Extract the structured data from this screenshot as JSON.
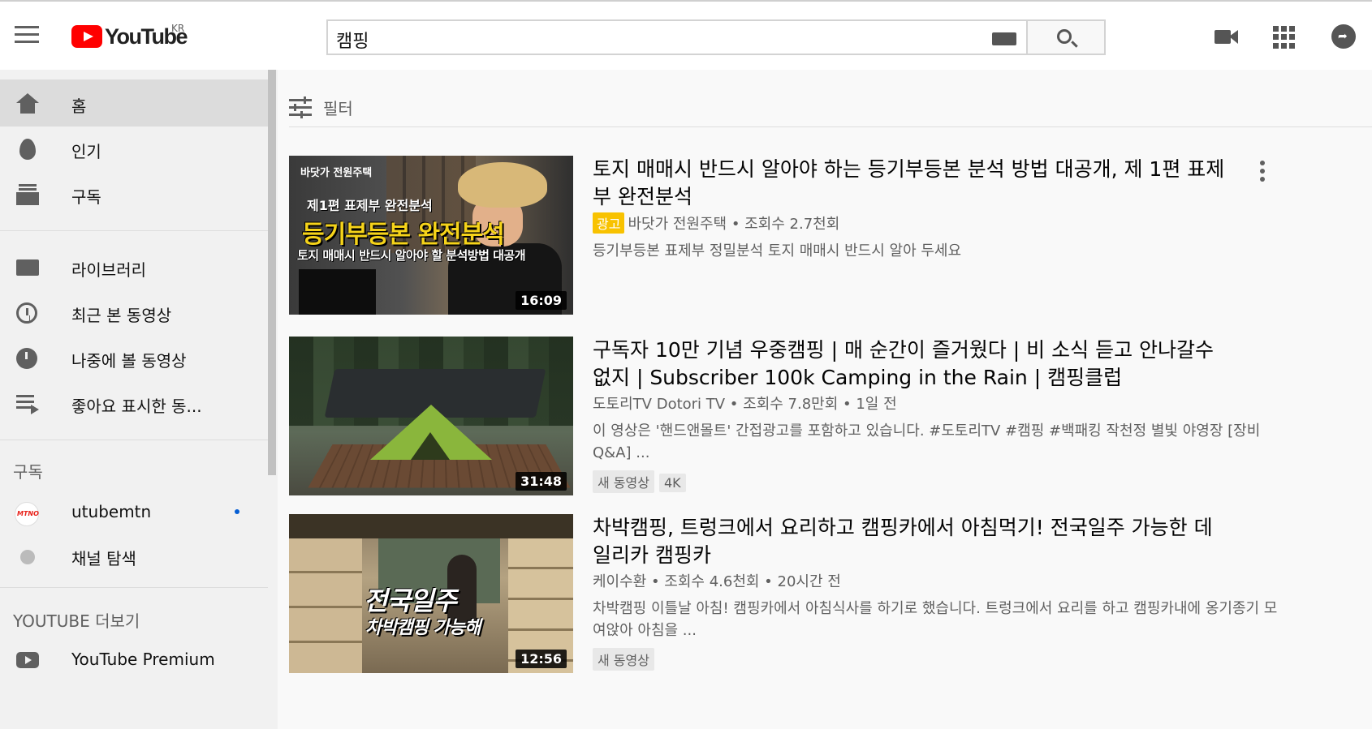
{
  "header": {
    "logo_text": "YouTube",
    "region": "KR",
    "search_query": "캠핑"
  },
  "sidebar": {
    "main_items": [
      {
        "label": "홈",
        "icon": "home-icon",
        "active": true
      },
      {
        "label": "인기",
        "icon": "fire-icon"
      },
      {
        "label": "구독",
        "icon": "subscriptions-icon"
      }
    ],
    "library_items": [
      {
        "label": "라이브러리",
        "icon": "folder-icon"
      },
      {
        "label": "최근 본 동영상",
        "icon": "history-icon"
      },
      {
        "label": "나중에 볼 동영상",
        "icon": "clock-icon"
      },
      {
        "label": "좋아요 표시한 동...",
        "icon": "playlist-icon"
      }
    ],
    "subscriptions_title": "구독",
    "subscriptions": [
      {
        "label": "utubemtn",
        "avatar_text": "MTNO",
        "new_content": true
      },
      {
        "label": "채널 탐색",
        "icon": "add-circle-icon"
      }
    ],
    "more_title": "YOUTUBE 더보기",
    "more_items": [
      {
        "label": "YouTube Premium",
        "icon": "youtube-icon"
      }
    ]
  },
  "filter": {
    "label": "필터"
  },
  "videos": [
    {
      "title": "토지 매매시 반드시 알아야 하는 등기부등본 분석 방법 대공개, 제 1편 표제부 완전분석",
      "ad_label": "광고",
      "channel": "바닷가 전원주택",
      "views": "조회수 2.7천회",
      "meta_line": "바닷가 전원주택 • 조회수 2.7천회",
      "description": "등기부등본 표제부 정밀분석 토지 매매시 반드시 알아 두세요",
      "duration": "16:09",
      "thumb_text": [
        "바닷가 전원주택",
        "제1편 표제부 완전분석",
        "등기부등본 완전분석",
        "토지 매매시 반드시 알아야 할 분석방법 대공개"
      ]
    },
    {
      "title": "구독자 10만 기념 우중캠핑 | 매 순간이 즐거웠다 | 비 소식 듣고 안나갈수 없지 | Subscriber 100k Camping in the Rain | 캠핑클럽",
      "meta_line": "도토리TV Dotori TV • 조회수 7.8만회 • 1일 전",
      "description": "이 영상은 '핸드앤몰트' 간접광고를 포함하고 있습니다. #도토리TV #캠핑 #백패킹 작천정 별빛 야영장 [장비Q&A] ...",
      "badges": [
        "새 동영상",
        "4K"
      ],
      "duration": "31:48"
    },
    {
      "title": "차박캠핑, 트렁크에서 요리하고 캠핑카에서 아침먹기! 전국일주 가능한 데일리카 캠핑카",
      "meta_line": "케이수환 • 조회수 4.6천회 • 20시간 전",
      "description": "차박캠핑 이틀날 아침! 캠핑카에서 아침식사를 하기로 했습니다. 트렁크에서 요리를 하고 캠핑카내에 옹기종기 모여앉아 아침을 ...",
      "badges": [
        "새 동영상"
      ],
      "duration": "12:56",
      "thumb_text": [
        "전국일주",
        "차박캠핑 가능해"
      ]
    }
  ],
  "colors": {
    "brand_red": "#ff0000",
    "ad_yellow": "#f8c200",
    "sidebar_bg": "#f1f1f1",
    "page_bg": "#f9f9f9"
  }
}
